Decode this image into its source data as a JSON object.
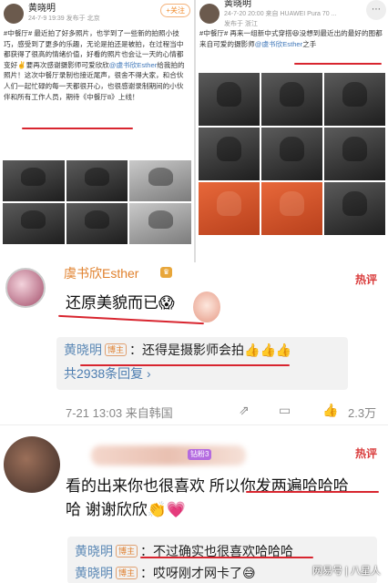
{
  "post_left": {
    "name": "黄晓明",
    "time": "24-7-9 19:39  发布于 北京",
    "follow": "+关注",
    "text": "#中餐厅# 最近拍了好多照片，也学到了一些新的拍照小技巧，感受到了更多的乐趣，无论是拍还是被拍，在过程当中都获得了很高的情绪价值，好看的照片也会让一天的心情都变好✌️要再次感谢摄影师可爱欣欣",
    "mention": "@虞书欣Esther",
    "text2": "给我拍的照片！这次中餐厅录制也接近尾声，很舍不得大家，和合伙人们一起忙碌的每一天都很开心，也很感谢录制期间的小伙伴和所有工作人员，期待《中餐厅8》上线！"
  },
  "post_right": {
    "name": "黄晓明",
    "time": "24-7-20 20:00  来自 HUAWEI Pura 70 ...",
    "sub": "发布于 浙江",
    "text": "#中餐厅# 再来一组新中式穿搭😆没想到最近出的最好的图都来自可爱的摄影师",
    "mention": "@虞书欣Esther",
    "text2": "之手"
  },
  "comment1": {
    "name": "虞书欣Esther",
    "hot": "热评",
    "text": "还原美貌而已😱",
    "reply_name": "黄晓明",
    "reply_tag": "博主",
    "reply_text": "：还得是摄影师会拍👍👍👍",
    "more": "共2938条回复 ›",
    "time": "7-21 13:03  来自韩国",
    "likes": "2.3万"
  },
  "comment2": {
    "badge": "钻粉3",
    "hot": "热评",
    "line1": "看的出来你也很喜欢 所以你发两遍哈哈哈",
    "line2": "哈 谢谢欣欣👏💗",
    "reply1_name": "黄晓明",
    "reply1_tag": "博主",
    "reply1_text": "：不过确实也很喜欢哈哈哈",
    "reply2_name": "黄晓明",
    "reply2_tag": "博主",
    "reply2_text": "：哎呀刚才网卡了😅"
  },
  "watermark": "网易号 | 八星人"
}
